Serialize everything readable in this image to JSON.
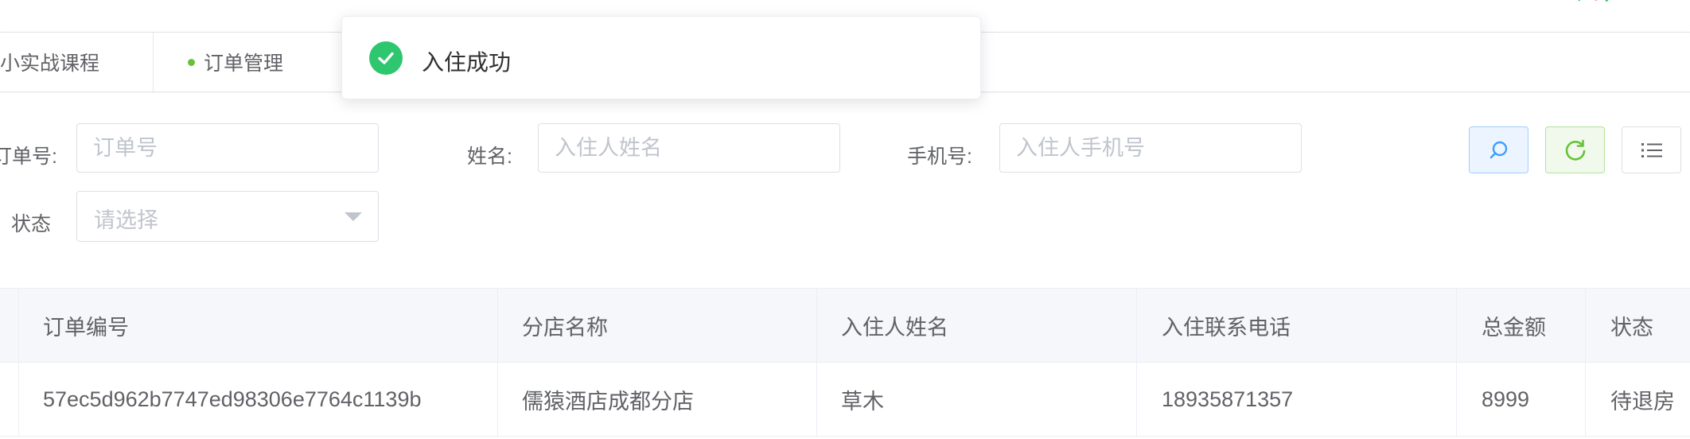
{
  "tabs": [
    {
      "label": "小实战课程",
      "active": false
    },
    {
      "label": "订单管理",
      "active": true
    }
  ],
  "toast": {
    "type": "success",
    "text": "入住成功",
    "icon": "check-circle-icon",
    "color": "#2ec66e"
  },
  "filters": {
    "order_no": {
      "label": "订单号:",
      "placeholder": "订单号",
      "value": ""
    },
    "name": {
      "label": "姓名:",
      "placeholder": "入住人姓名",
      "value": ""
    },
    "phone": {
      "label": "手机号:",
      "placeholder": "入住人手机号",
      "value": ""
    },
    "status": {
      "label": "状态",
      "placeholder": "请选择",
      "value": ""
    }
  },
  "toolbar": {
    "search_icon": "search-icon",
    "refresh_icon": "refresh-icon",
    "columns_icon": "list-icon"
  },
  "table": {
    "columns": [
      "订单编号",
      "分店名称",
      "入住人姓名",
      "入住联系电话",
      "总金额",
      "状态"
    ],
    "rows": [
      [
        "57ec5d962b7747ed98306e7764c1139b",
        "儒猿酒店成都分店",
        "草木",
        "18935871357",
        "8999",
        "待退房"
      ]
    ]
  },
  "colors": {
    "accent_blue": "#409eff",
    "success_green": "#67c23a",
    "header_bg": "#f5f7fa"
  }
}
